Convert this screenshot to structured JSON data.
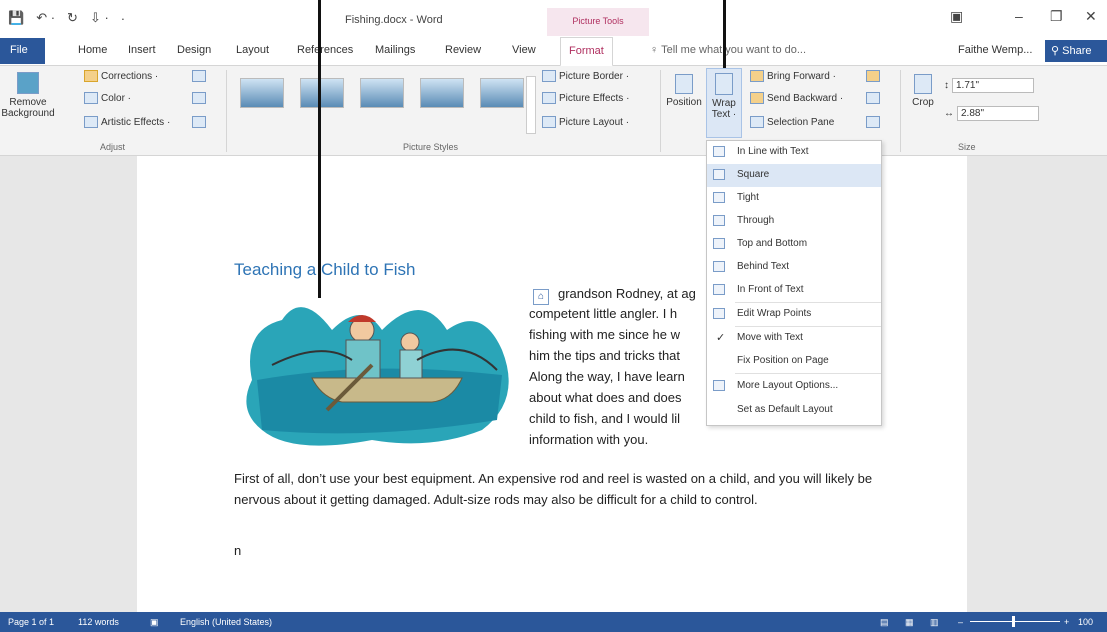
{
  "title": {
    "qat": [
      "💾",
      "↶ ·",
      "↻",
      "⇩ ·",
      "·"
    ],
    "doc_title": "Fishing.docx - Word",
    "tools_label": "Picture Tools",
    "controls": [
      "▣",
      "–",
      "❐",
      "✕"
    ]
  },
  "tabs": {
    "file": "File",
    "items": [
      "Home",
      "Insert",
      "Design",
      "Layout",
      "References",
      "Mailings",
      "Review",
      "View"
    ],
    "format": "Format",
    "tell": "Tell me what you want to do...",
    "user": "Faithe Wemp...",
    "share": "Share"
  },
  "ribbon": {
    "remove_bg": "Remove Background",
    "corrections": "Corrections ·",
    "color": "Color ·",
    "artistic": "Artistic Effects ·",
    "adjust_label": "Adjust",
    "styles_label": "Picture Styles",
    "border": "Picture Border ·",
    "effects": "Picture Effects ·",
    "layout": "Picture Layout ·",
    "position": "Position",
    "wrap": "Wrap Text ·",
    "bring": "Bring Forward ·",
    "send": "Send Backward ·",
    "selection": "Selection Pane",
    "crop": "Crop",
    "height": "1.71\"",
    "width": "2.88\"",
    "size_label": "Size"
  },
  "menu": {
    "items": [
      "In Line with Text",
      "Square",
      "Tight",
      "Through",
      "Top and Bottom",
      "Behind Text",
      "In Front of Text",
      "Edit Wrap Points",
      "Move with Text",
      "Fix Position on Page",
      "More Layout Options...",
      "Set as Default Layout"
    ],
    "highlighted": "Square",
    "checked": "Move with Text"
  },
  "doc": {
    "heading": "Teaching a Child to Fish",
    "lines": [
      "grandson Rodney, at ag",
      "competent little angler. I h",
      "fishing with me since he w",
      "him the tips and tricks that",
      "Along the way, I have learn",
      "about what does and does",
      "child to fish, and I would lil",
      "information with you."
    ],
    "para2": "First of all, don’t use your best equipment. An expensive rod and reel is wasted on a child, and you will likely be nervous about it getting damaged. Adult-size rods may also be difficult for a child to control.",
    "para3": "n"
  },
  "status": {
    "page": "Page 1 of 1",
    "words": "112 words",
    "lang": "English (United States)",
    "zoom": "100"
  },
  "colors": {
    "accent": "#2b579a",
    "format_tab": "#b03060",
    "heading": "#2e74b5"
  }
}
